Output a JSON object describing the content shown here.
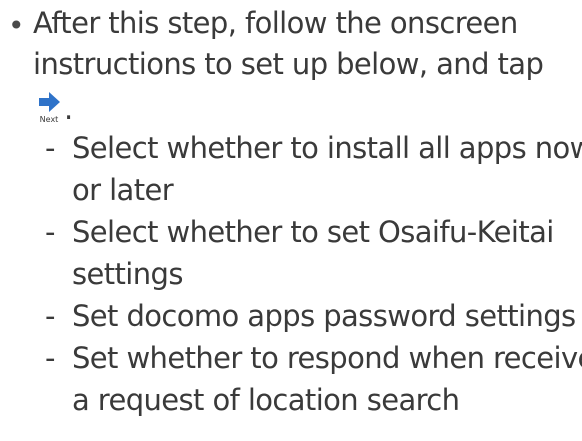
{
  "intro": {
    "bullet": "•",
    "line1": "After this step, follow the onscreen",
    "line2": "instructions to set up below, and tap",
    "period": "."
  },
  "next_icon": {
    "icon": "next-arrow-icon",
    "label": "Next",
    "arrow_color": "#2f73c9"
  },
  "steps": [
    {
      "dash": "-",
      "lines": [
        "Select whether to install all apps now",
        "or later"
      ]
    },
    {
      "dash": "-",
      "lines": [
        "Select whether to set Osaifu-Keitai",
        "settings"
      ]
    },
    {
      "dash": "-",
      "lines": [
        "Set docomo apps password settings"
      ]
    },
    {
      "dash": "-",
      "lines": [
        "Set whether to respond when receive",
        "a request of location search"
      ]
    }
  ]
}
